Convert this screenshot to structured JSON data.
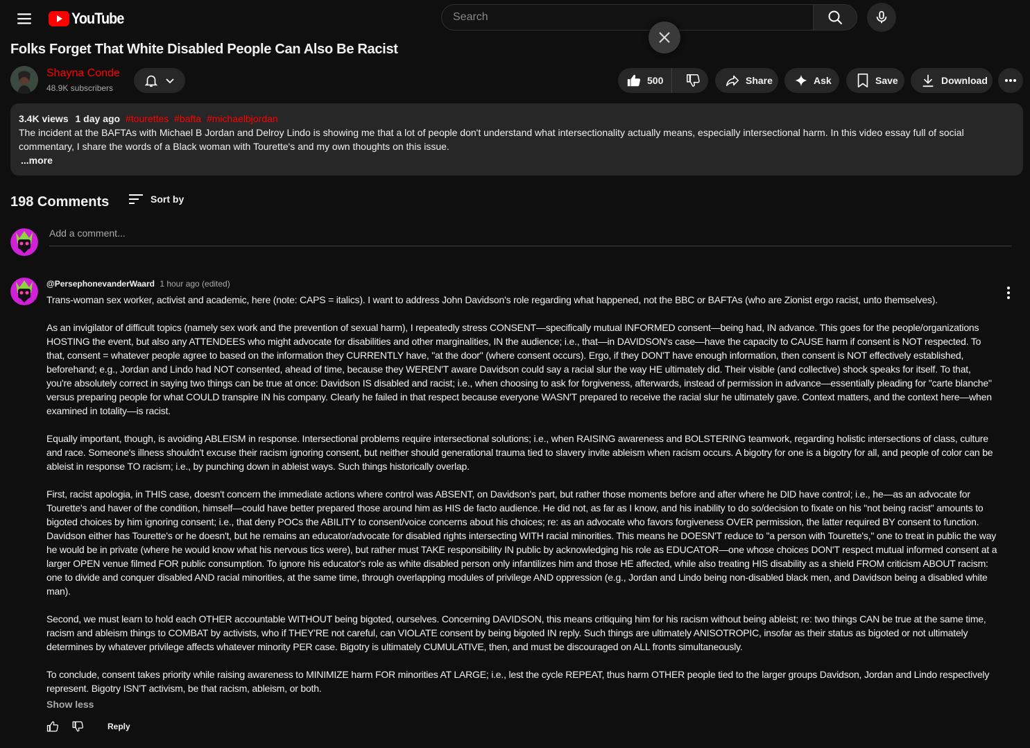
{
  "topbar": {
    "logo_text": "YouTube",
    "search_placeholder": "Search"
  },
  "video": {
    "title": "Folks Forget That White Disabled People Can Also Be Racist",
    "channel_name": "Shayna Conde",
    "subscribers": "48.9K subscribers",
    "likes": "500"
  },
  "actions": {
    "share": "Share",
    "ask": "Ask",
    "save": "Save",
    "download": "Download"
  },
  "description": {
    "views": "3.4K views",
    "date": "1 day ago",
    "tags": [
      "#tourettes",
      "#bafta",
      "#michaelbjordan"
    ],
    "text": "The incident at the BAFTAs with Michael B Jordan and Delroy Lindo is showing me that a lot of people don't understand what intersectionality actually means, especially intersectional harm. In this video essay full of social commentary, I share the words of a Black woman with Tourette's and my own thoughts on this issue.",
    "more": "...more"
  },
  "comments": {
    "count_label": "198 Comments",
    "sort_label": "Sort by",
    "add_placeholder": "Add a comment...",
    "first": {
      "author": "@PersephonevanderWaard",
      "time": "1 hour ago (edited)",
      "paragraphs": [
        "Trans-woman sex worker, activist and academic, here (note: CAPS = italics). I want to address John Davidson's role regarding what happened, not the BBC or BAFTAs (who are Zionist ergo racist, unto themselves).",
        "As an invigilator of difficult topics (namely sex work and the prevention of sexual harm), I repeatedly stress CONSENT—specifically mutual INFORMED consent—being had, IN advance. This goes for the people/organizations HOSTING the event, but also any ATTENDEES who might advocate for disabilities and other marginalities, IN the audience; i.e., that—in DAVIDSON's case—have the capacity to CAUSE harm if consent is NOT respected. To that, consent = whatever people agree to based on the information they CURRENTLY have, \"at the door\" (where consent occurs). Ergo, if they DON'T have enough information, then consent is NOT effectively established, beforehand; e.g., Jordan and Lindo had NOT consented, ahead of time, because they WEREN'T aware Davidson could say a racial slur the way HE ultimately did. Their visible (and collective) shock speaks for itself. To that, you're absolutely correct in saying two things can be true at once: Davidson IS disabled and racist; i.e., when choosing to ask for forgiveness, afterwards, instead of permission in advance—essentially pleading for \"carte blanche\" versus preparing people for what COULD transpire IN his company. Clearly he failed in that respect because everyone WASN'T prepared to receive the racial slur he ultimately gave. Context matters, and the context here—when examined in totality—is racist.",
        "Equally important, though, is avoiding ABLEISM in response. Intersectional problems require intersectional solutions; i.e., when RAISING awareness and BOLSTERING teamwork, regarding holistic intersections of class, culture and race. Someone's illness shouldn't excuse their racism ignoring consent, but neither should generational trauma tied to slavery invite ableism when racism occurs. A bigotry for one is a bigotry for all, and people of color can be ableist in response TO racism; i.e., by punching down in ableist ways. Such things historically overlap.",
        "First, racist apologia, in THIS case, doesn't concern the immediate actions where control was ABSENT, on Davidson's part, but rather those moments before and after where he DID have control; i.e., he—as an advocate for Tourette's and haver of the condition, himself—could have better prepared those around him as HIS de facto audience. He did not, as far as I know, and his inability to do so/decision to fixate on his \"not being racist\" amounts to bigoted choices by him ignoring consent; i.e., that deny POCs the ABILITY to consent/voice concerns about his choices; re: as an advocate who favors forgiveness OVER permission, the latter required BY consent to function. Davidson either has Tourette's or he doesn't, but he remains an educator/advocate for disabled rights intersecting WITH racial minorities. This means he DOESN'T reduce to \"a person with Tourette's,\" one to treat in public the way he would be in private (where he would know what his nervous tics were), but rather must TAKE responsibility IN public by acknowledging his role as EDUCATOR—one whose choices DON'T respect mutual informed consent at a larger OPEN venue filmed FOR public consumption. To ignore his educator's role as white disabled person only infantilizes him and those HE affected, while also treating HIS disability as a shield FROM criticism ABOUT racism: one to divide and conquer disabled AND racial minorities, at the same time, through overlapping modules of privilege AND oppression (e.g., Jordan and Lindo being non-disabled black men, and Davidson being a disabled white man).",
        "Second, we must learn to hold each OTHER accountable WITHOUT being bigoted, ourselves. Concerning DAVIDSON, this means critiquing him for his racism without being ableist; re: two things CAN be true at the same time, racism and ableism things to COMBAT by activists, who if THEY'RE not careful, can VIOLATE consent by being bigoted IN reply. Such things are ultimately ANISOTROPIC, insofar as their status as bigoted or not ultimately determines by whatever privilege affects whatever minority PER case. Bigotry is ultimately CUMULATIVE, then, and must be discouraged on ALL fronts simultaneously.",
        "To conclude, consent takes priority while raising awareness to MINIMIZE harm FOR minorities AT LARGE; i.e., lest the cycle REPEAT, thus harm OTHER people tied to the larger groups Davidson, Jordan and Lindo respectively represent. Bigotry ISN'T activism, be that racism, ableism, or both."
      ],
      "show_less": "Show less",
      "reply": "Reply"
    }
  },
  "colors": {
    "background": "#0f0f0f",
    "surface": "#272727",
    "accent": "#ff0000",
    "muted": "#aaaaaa"
  }
}
